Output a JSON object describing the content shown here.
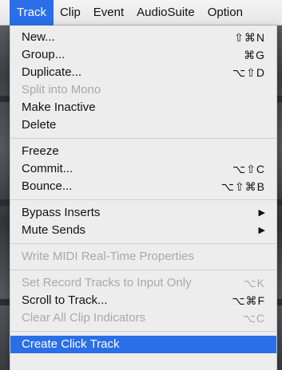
{
  "menubar": {
    "items": [
      "Track",
      "Clip",
      "Event",
      "AudioSuite",
      "Option"
    ],
    "active_index": 0
  },
  "menu": {
    "group1": [
      {
        "label": "New...",
        "shortcut": "⇧⌘N",
        "enabled": true
      },
      {
        "label": "Group...",
        "shortcut": "⌘G",
        "enabled": true
      },
      {
        "label": "Duplicate...",
        "shortcut": "⌥⇧D",
        "enabled": true
      },
      {
        "label": "Split into Mono",
        "shortcut": "",
        "enabled": false
      },
      {
        "label": "Make Inactive",
        "shortcut": "",
        "enabled": true
      },
      {
        "label": "Delete",
        "shortcut": "",
        "enabled": true
      }
    ],
    "group2": [
      {
        "label": "Freeze",
        "shortcut": "",
        "enabled": true
      },
      {
        "label": "Commit...",
        "shortcut": "⌥⇧C",
        "enabled": true
      },
      {
        "label": "Bounce...",
        "shortcut": "⌥⇧⌘B",
        "enabled": true
      }
    ],
    "group3": [
      {
        "label": "Bypass Inserts",
        "submenu": true,
        "enabled": true
      },
      {
        "label": "Mute Sends",
        "submenu": true,
        "enabled": true
      }
    ],
    "group4": [
      {
        "label": "Write MIDI Real-Time Properties",
        "shortcut": "",
        "enabled": false
      }
    ],
    "group5": [
      {
        "label": "Set Record Tracks to Input Only",
        "shortcut": "⌥K",
        "enabled": false
      },
      {
        "label": "Scroll to Track...",
        "shortcut": "⌥⌘F",
        "enabled": true
      },
      {
        "label": "Clear All Clip Indicators",
        "shortcut": "⌥C",
        "enabled": false
      }
    ],
    "group6": [
      {
        "label": "Create Click Track",
        "shortcut": "",
        "enabled": true,
        "highlighted": true
      }
    ],
    "submenu_arrow": "▶"
  },
  "colors": {
    "highlight": "#2a6ee8",
    "menu_bg": "#ededed",
    "disabled_text": "#a9a9a9"
  }
}
